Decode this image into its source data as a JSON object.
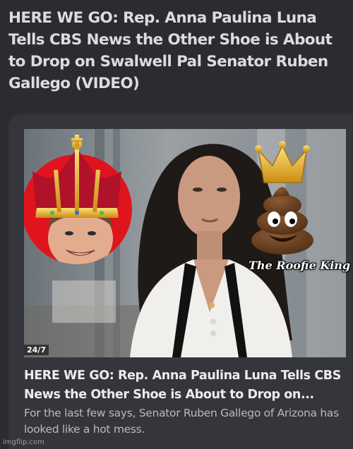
{
  "article": {
    "headline": "HERE WE GO: Rep. Anna Paulina Luna Tells CBS News the Other Shoe is About to Drop on Swalwell Pal Senator Ruben Gallego (VIDEO)"
  },
  "card": {
    "title": "HERE WE GO: Rep. Anna Paulina Luna Tells CBS News the Other Shoe is About to Drop on...",
    "summary": "For the last few says, Senator Ruben Gallego of Arizona has looked like a hot mess."
  },
  "photo": {
    "overlay_caption": "The Roofie King",
    "network_tag": "24/7",
    "icons": [
      "crowned-portrait-badge",
      "crowned-poop-emoji"
    ]
  },
  "watermark": "imgflip.com",
  "colors": {
    "background": "#2b2c30",
    "card": "#35363b",
    "badge_red": "#e0141c",
    "crown_gold": "#e8b52c"
  }
}
